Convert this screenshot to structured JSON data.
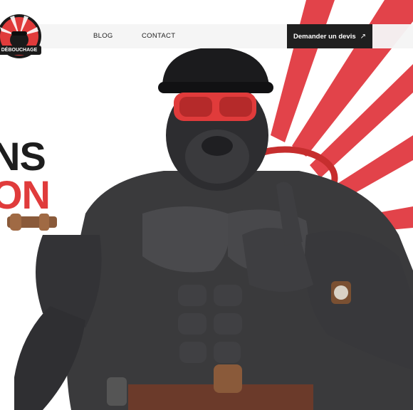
{
  "brand": {
    "logo_text": "DÉBOUCHAGE",
    "accent_color": "#e03b3b",
    "dark_color": "#1f1f1f"
  },
  "nav": {
    "links": [
      {
        "label": "BLOG"
      },
      {
        "label": "CONTACT"
      }
    ],
    "cta_label": "Demander un devis",
    "cta_icon": "arrow-up-right-icon"
  },
  "hero": {
    "headline_line1": "NS",
    "headline_line2": "ON",
    "mascot": "gorilla-plumber-illustration"
  }
}
